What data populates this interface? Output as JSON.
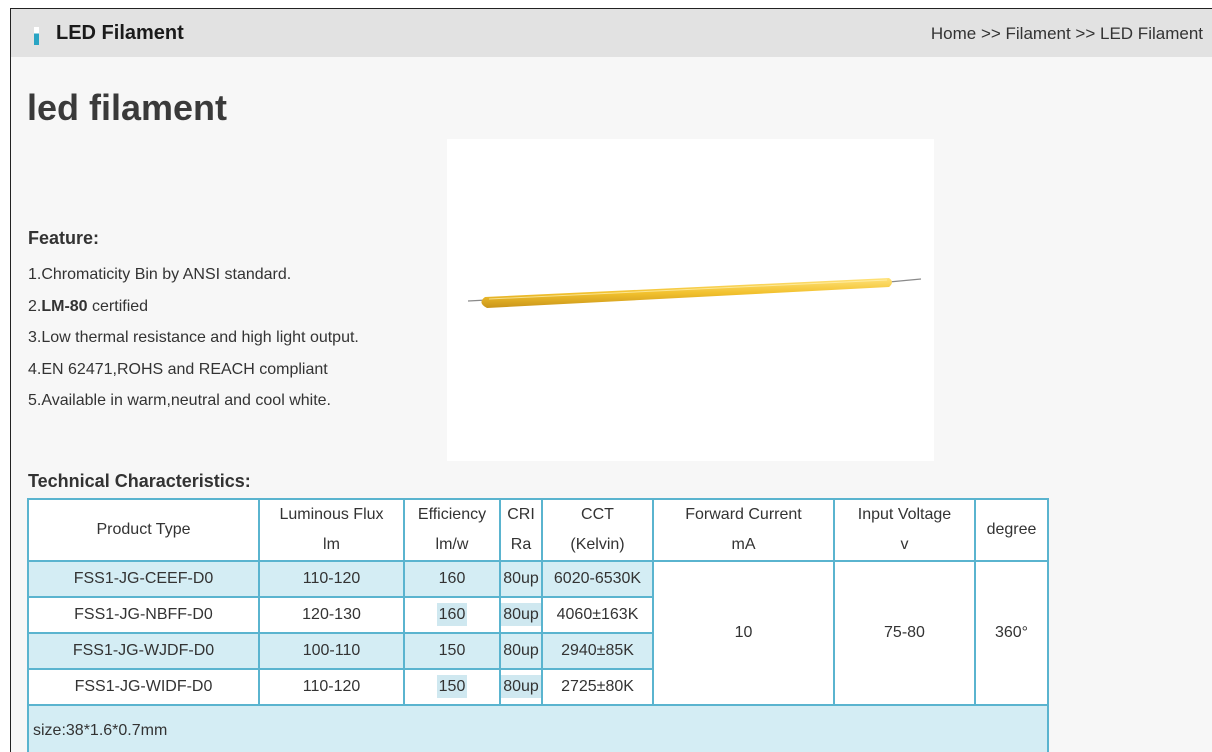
{
  "header": {
    "title": "LED Filament",
    "breadcrumb": "Home >> Filament >> LED Filament"
  },
  "page_title": "led filament",
  "product_image": {
    "icon": "led-filament-strip",
    "filament_color": "#f2c12e"
  },
  "features": {
    "heading": "Feature:",
    "items": [
      {
        "prefix": "1.",
        "bold": "",
        "text": "Chromaticity Bin by ANSI standard."
      },
      {
        "prefix": "2.",
        "bold": "LM-80",
        "text": " certified"
      },
      {
        "prefix": "3.",
        "bold": "",
        "text": "Low thermal resistance and high light output."
      },
      {
        "prefix": "4.",
        "bold": "",
        "text": "EN 62471,ROHS and REACH compliant"
      },
      {
        "prefix": "5.",
        "bold": "",
        "text": "Available in warm,neutral and cool white."
      }
    ]
  },
  "tech": {
    "heading": "Technical Characteristics:",
    "columns": [
      {
        "l1": "Product Type",
        "l2": ""
      },
      {
        "l1": "Luminous Flux",
        "l2": "lm"
      },
      {
        "l1": "Efficiency",
        "l2": "lm/w"
      },
      {
        "l1": "CRI",
        "l2": "Ra"
      },
      {
        "l1": "CCT",
        "l2": "(Kelvin)"
      },
      {
        "l1": "Forward Current",
        "l2": "mA"
      },
      {
        "l1": "Input Voltage",
        "l2": "v"
      },
      {
        "l1": "degree",
        "l2": ""
      }
    ],
    "rows": [
      {
        "type": "FSS1-JG-CEEF-D0",
        "flux": "110-120",
        "eff": "160",
        "cri": "80up",
        "cct": "6020-6530K"
      },
      {
        "type": "FSS1-JG-NBFF-D0",
        "flux": "120-130",
        "eff": "160",
        "cri": "80up",
        "cct": "4060±163K"
      },
      {
        "type": "FSS1-JG-WJDF-D0",
        "flux": "100-110",
        "eff": "150",
        "cri": "80up",
        "cct": "2940±85K"
      },
      {
        "type": "FSS1-JG-WIDF-D0",
        "flux": "110-120",
        "eff": "150",
        "cri": "80up",
        "cct": "2725±80K"
      }
    ],
    "forward_current": "10",
    "input_voltage": "75-80",
    "degree": "360°",
    "size_note": "size:38*1.6*0.7mm"
  },
  "colors": {
    "accent": "#2aa5c4",
    "table_border": "#5ab4cf",
    "row_shade": "#d4edf4",
    "header_bar": "#e2e2e2"
  }
}
